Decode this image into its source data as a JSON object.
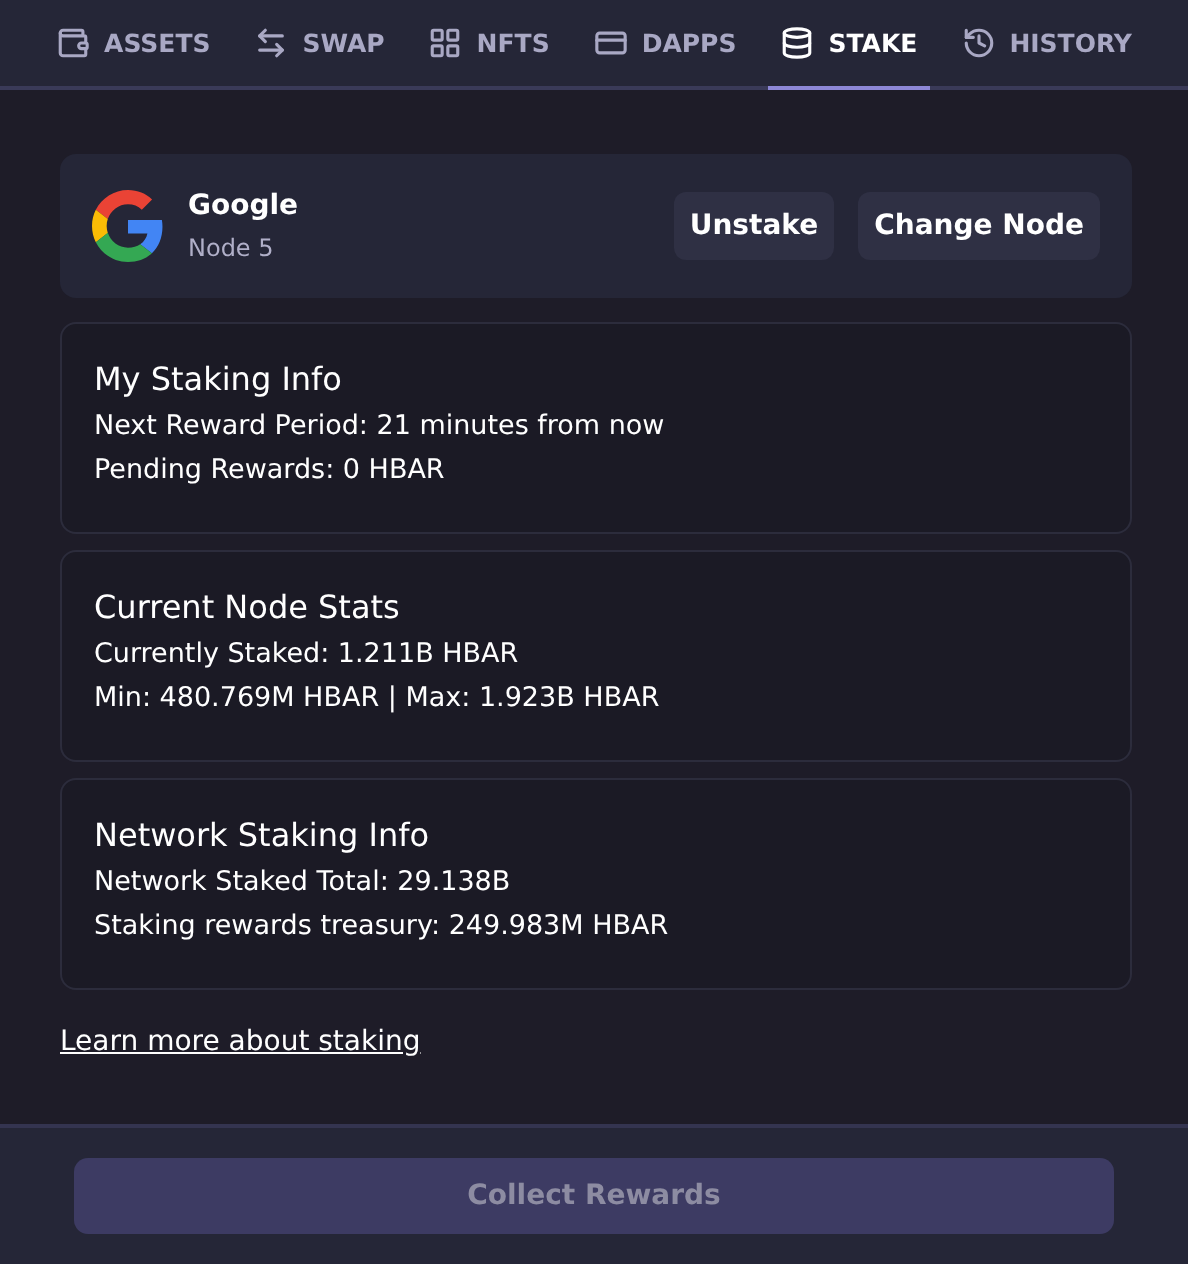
{
  "tabs": [
    {
      "label": "ASSETS",
      "kind": "wallet",
      "selected": false
    },
    {
      "label": "SWAP",
      "kind": "swap",
      "selected": false
    },
    {
      "label": "NFTS",
      "kind": "grid",
      "selected": false
    },
    {
      "label": "DAPPS",
      "kind": "card",
      "selected": false
    },
    {
      "label": "STAKE",
      "kind": "stack",
      "selected": true
    },
    {
      "label": "HISTORY",
      "kind": "history",
      "selected": false
    }
  ],
  "node": {
    "name": "Google",
    "subtitle": "Node 5",
    "buttons": [
      "Unstake",
      "Change Node"
    ]
  },
  "info_cards": [
    {
      "title": "My Staking Info",
      "lines": [
        "Next Reward Period: 21 minutes from now",
        "Pending Rewards: 0 HBAR"
      ]
    },
    {
      "title": "Current Node Stats",
      "lines": [
        "Currently Staked: 1.211B HBAR",
        "Min: 480.769M HBAR | Max: 1.923B HBAR"
      ]
    },
    {
      "title": "Network Staking Info",
      "lines": [
        "Network Staked Total: 29.138B",
        "Staking rewards treasury: 249.983M HBAR"
      ]
    }
  ],
  "learn_link": "Learn more about staking",
  "collect_button": {
    "label": "Collect Rewards",
    "disabled": true
  }
}
